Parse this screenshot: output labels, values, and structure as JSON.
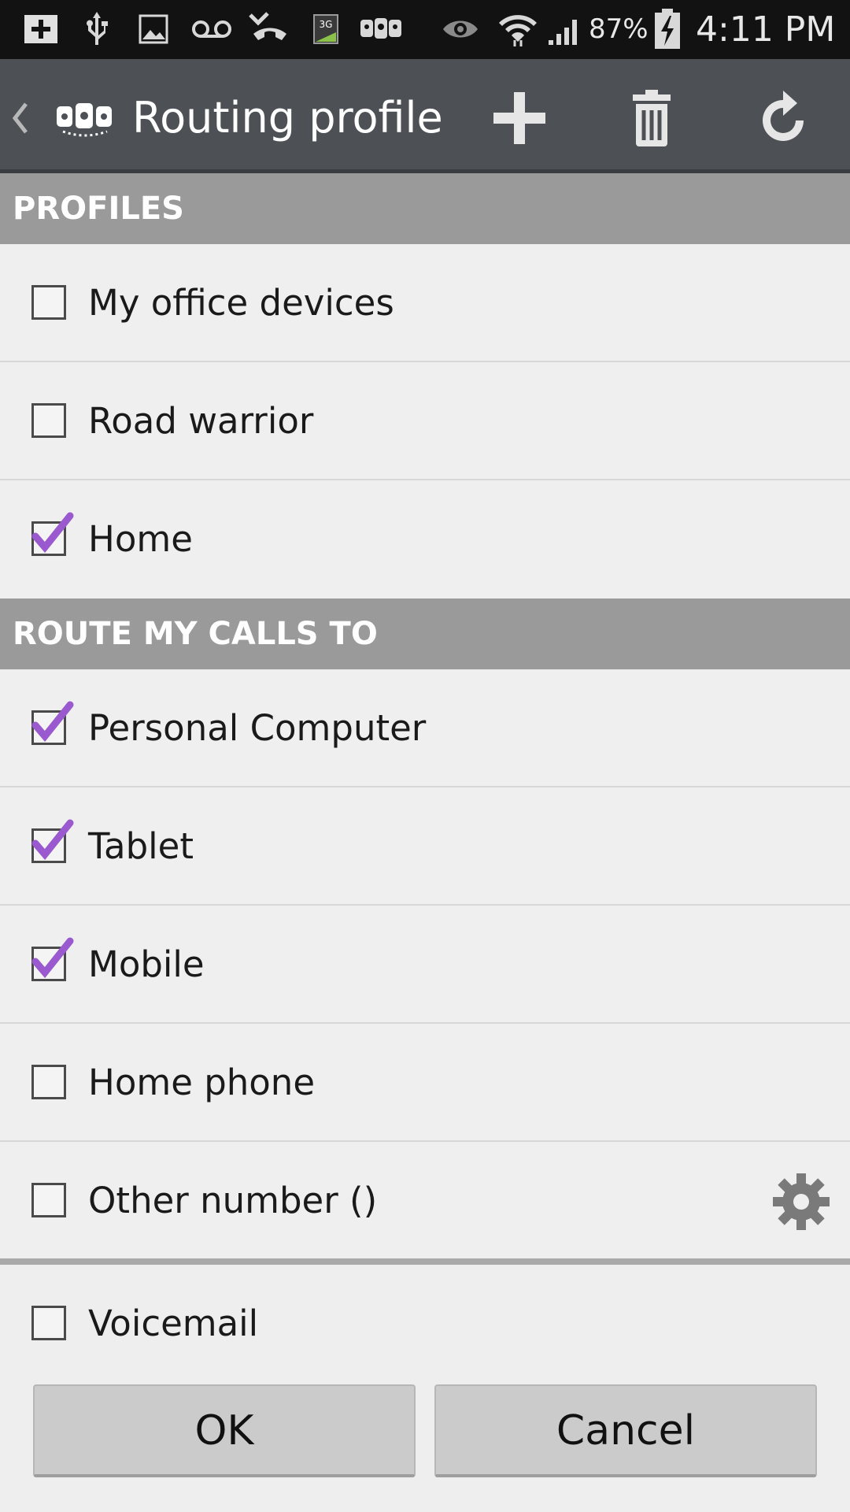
{
  "status_bar": {
    "battery": "87%",
    "time": "4:11 PM",
    "icons": [
      "add-box-icon",
      "usb-icon",
      "image-icon",
      "voicemail-icon",
      "missed-call-icon",
      "3g-icon",
      "app-logo-icon",
      "eye-icon",
      "wifi-icon",
      "signal-icon",
      "battery-charging-icon"
    ]
  },
  "action_bar": {
    "title": "Routing profile",
    "actions": [
      "add-icon",
      "delete-icon",
      "refresh-icon"
    ]
  },
  "profiles": {
    "header": "PROFILES",
    "items": [
      {
        "label": "My office devices",
        "checked": false
      },
      {
        "label": "Road warrior",
        "checked": false
      },
      {
        "label": "Home",
        "checked": true
      }
    ]
  },
  "route": {
    "header": "ROUTE MY CALLS TO",
    "items": [
      {
        "label": "Personal Computer",
        "checked": true
      },
      {
        "label": "Tablet",
        "checked": true
      },
      {
        "label": "Mobile",
        "checked": true
      },
      {
        "label": "Home phone",
        "checked": false
      },
      {
        "label": "Other number ()",
        "checked": false
      }
    ]
  },
  "voicemail": {
    "label": "Voicemail",
    "checked": false
  },
  "buttons": {
    "ok": "OK",
    "cancel": "Cancel"
  },
  "colors": {
    "check": "#9b59d0",
    "header_bg": "#9a9a9a",
    "action_bar": "#4d5156"
  }
}
